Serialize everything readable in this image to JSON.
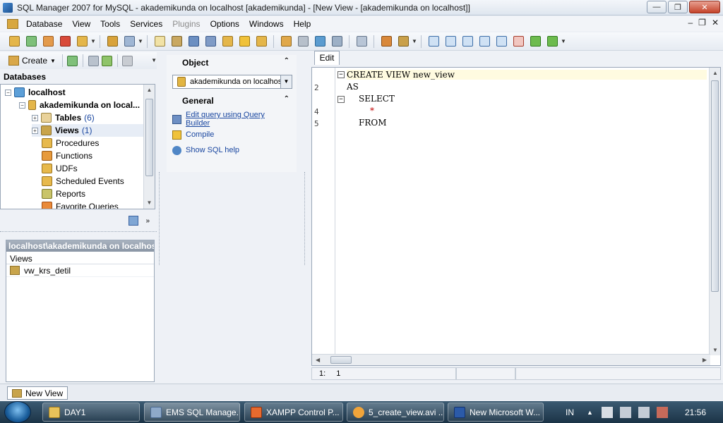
{
  "window": {
    "title": "SQL Manager 2007 for MySQL - akademikunda on localhost [akademikunda] - [New View - [akademikunda on localhost]]"
  },
  "menu": [
    "Database",
    "View",
    "Tools",
    "Services",
    "Plugins",
    "Options",
    "Windows",
    "Help"
  ],
  "db_toolbar": {
    "create_label": "Create"
  },
  "explorer": {
    "header": "Databases",
    "tree": [
      {
        "label": "localhost",
        "count": ""
      },
      {
        "label": "akademikunda on local...",
        "count": ""
      },
      {
        "label": "Tables",
        "count": "(6)"
      },
      {
        "label": "Views",
        "count": "(1)"
      },
      {
        "label": "Procedures",
        "count": ""
      },
      {
        "label": "Functions",
        "count": ""
      },
      {
        "label": "UDFs",
        "count": ""
      },
      {
        "label": "Scheduled Events",
        "count": ""
      },
      {
        "label": "Reports",
        "count": ""
      },
      {
        "label": "Favorite Queries",
        "count": ""
      }
    ]
  },
  "objects_panel": {
    "path": "localhost\\akademikunda on localhost\\",
    "column": "Views",
    "items": [
      "vw_krs_detil"
    ]
  },
  "navbar": {
    "object_header": "Object",
    "object_combo": "akademikunda on localhost",
    "general_header": "General",
    "links": [
      "Edit query using Query Builder",
      "Compile",
      "Show SQL help"
    ]
  },
  "editor": {
    "tab": "Edit",
    "line_numbers": [
      "2",
      "4",
      "5"
    ],
    "lines": [
      "CREATE VIEW new_view",
      "AS",
      "SELECT",
      "*",
      "FROM"
    ]
  },
  "status": {
    "line": "1:",
    "col": "1"
  },
  "window_tabs": [
    "New View"
  ],
  "taskbar": {
    "tasks": [
      "DAY1",
      "EMS SQL Manage...",
      "XAMPP Control P...",
      "5_create_view.avi ...",
      "New Microsoft W..."
    ],
    "lang": "IN",
    "clock": "21:56"
  }
}
